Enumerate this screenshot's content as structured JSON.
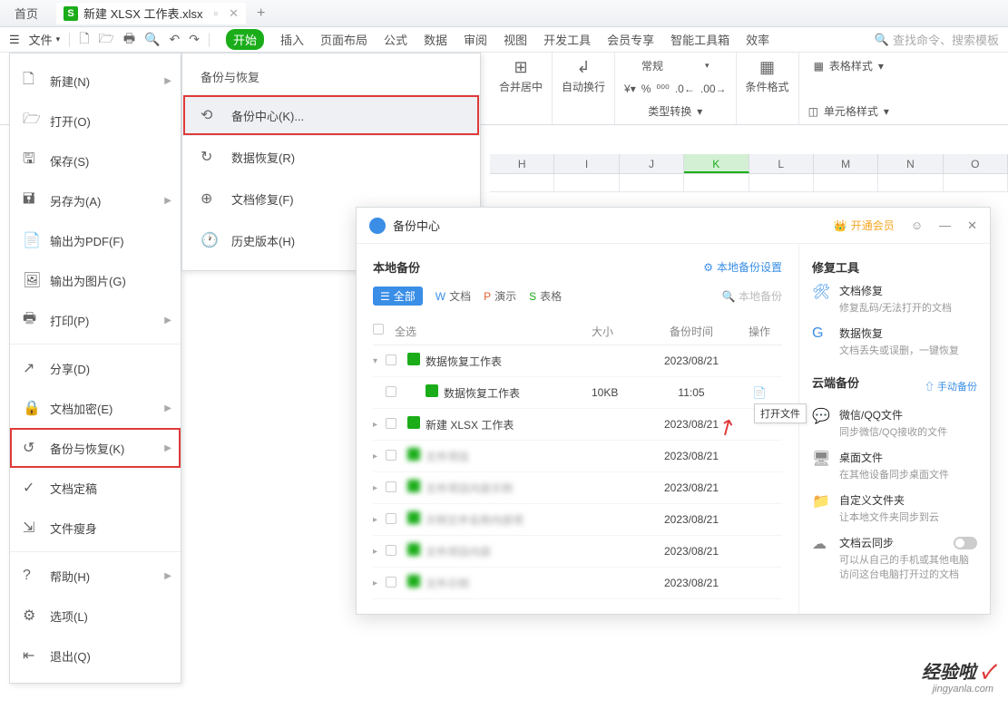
{
  "tabs": {
    "home": "首页",
    "doc_title": "新建 XLSX 工作表.xlsx"
  },
  "toolbar": {
    "file": "文件"
  },
  "menu": {
    "start": "开始",
    "insert": "插入",
    "layout": "页面布局",
    "formula": "公式",
    "data": "数据",
    "review": "审阅",
    "view": "视图",
    "dev": "开发工具",
    "member": "会员专享",
    "smart": "智能工具箱",
    "efficiency": "效率"
  },
  "search_placeholder": "查找命令、搜索模板",
  "ribbon": {
    "merge": "合并居中",
    "wrap": "自动换行",
    "general": "常规",
    "type_convert": "类型转换",
    "cond_format": "条件格式",
    "table_style": "表格样式",
    "cell_style": "单元格样式"
  },
  "file_menu": {
    "new": "新建(N)",
    "open": "打开(O)",
    "save": "保存(S)",
    "saveas": "另存为(A)",
    "export_pdf": "输出为PDF(F)",
    "export_img": "输出为图片(G)",
    "print": "打印(P)",
    "share": "分享(D)",
    "encrypt": "文档加密(E)",
    "backup": "备份与恢复(K)",
    "final": "文档定稿",
    "slim": "文件瘦身",
    "help": "帮助(H)",
    "options": "选项(L)",
    "exit": "退出(Q)"
  },
  "submenu": {
    "title": "备份与恢复",
    "center": "备份中心(K)...",
    "recover": "数据恢复(R)",
    "repair": "文档修复(F)",
    "history": "历史版本(H)"
  },
  "columns": [
    "H",
    "I",
    "J",
    "K",
    "L",
    "M",
    "N",
    "O"
  ],
  "backup": {
    "title": "备份中心",
    "member": "开通会员",
    "local_title": "本地备份",
    "local_settings": "本地备份设置",
    "filters": {
      "all": "全部",
      "doc": "文档",
      "ppt": "演示",
      "sheet": "表格"
    },
    "search_placeholder": "本地备份",
    "head": {
      "select_all": "全选",
      "size": "大小",
      "date": "备份时间",
      "op": "操作"
    },
    "rows": [
      {
        "name": "数据恢复工作表",
        "size": "",
        "date": "2023/08/21",
        "expandable": true,
        "open": true,
        "blur": false
      },
      {
        "name": "数据恢复工作表",
        "size": "10KB",
        "date": "11:05",
        "child": true,
        "hasOp": true,
        "blur": false
      },
      {
        "name": "新建 XLSX 工作表",
        "size": "",
        "date": "2023/08/21",
        "expandable": true,
        "blur": false
      },
      {
        "name": "文件项目",
        "size": "",
        "date": "2023/08/21",
        "expandable": true,
        "blur": true
      },
      {
        "name": "文件项目内容示例",
        "size": "",
        "date": "2023/08/21",
        "expandable": true,
        "blur": true
      },
      {
        "name": "示例文件名称内容项",
        "size": "",
        "date": "2023/08/21",
        "expandable": true,
        "blur": true
      },
      {
        "name": "文件项目内容",
        "size": "",
        "date": "2023/08/21",
        "expandable": true,
        "blur": true
      },
      {
        "name": "文件示例",
        "size": "",
        "date": "2023/08/21",
        "expandable": true,
        "blur": true
      }
    ],
    "tooltip": "打开文件",
    "repair": {
      "title": "修复工具",
      "doc_repair": "文档修复",
      "doc_repair_sub": "修复乱码/无法打开的文档",
      "data_recover": "数据恢复",
      "data_recover_sub": "文档丢失或误删，一键恢复"
    },
    "cloud": {
      "title": "云端备份",
      "manual": "手动备份",
      "wechat": "微信/QQ文件",
      "wechat_sub": "同步微信/QQ接收的文件",
      "desktop": "桌面文件",
      "desktop_sub": "在其他设备同步桌面文件",
      "custom": "自定义文件夹",
      "custom_sub": "让本地文件夹同步到云",
      "sync": "文档云同步",
      "sync_sub": "可以从自己的手机或其他电脑访问这台电脑打开过的文档"
    }
  },
  "watermark": {
    "brand": "经验啦",
    "url": "jingyanla.com"
  }
}
